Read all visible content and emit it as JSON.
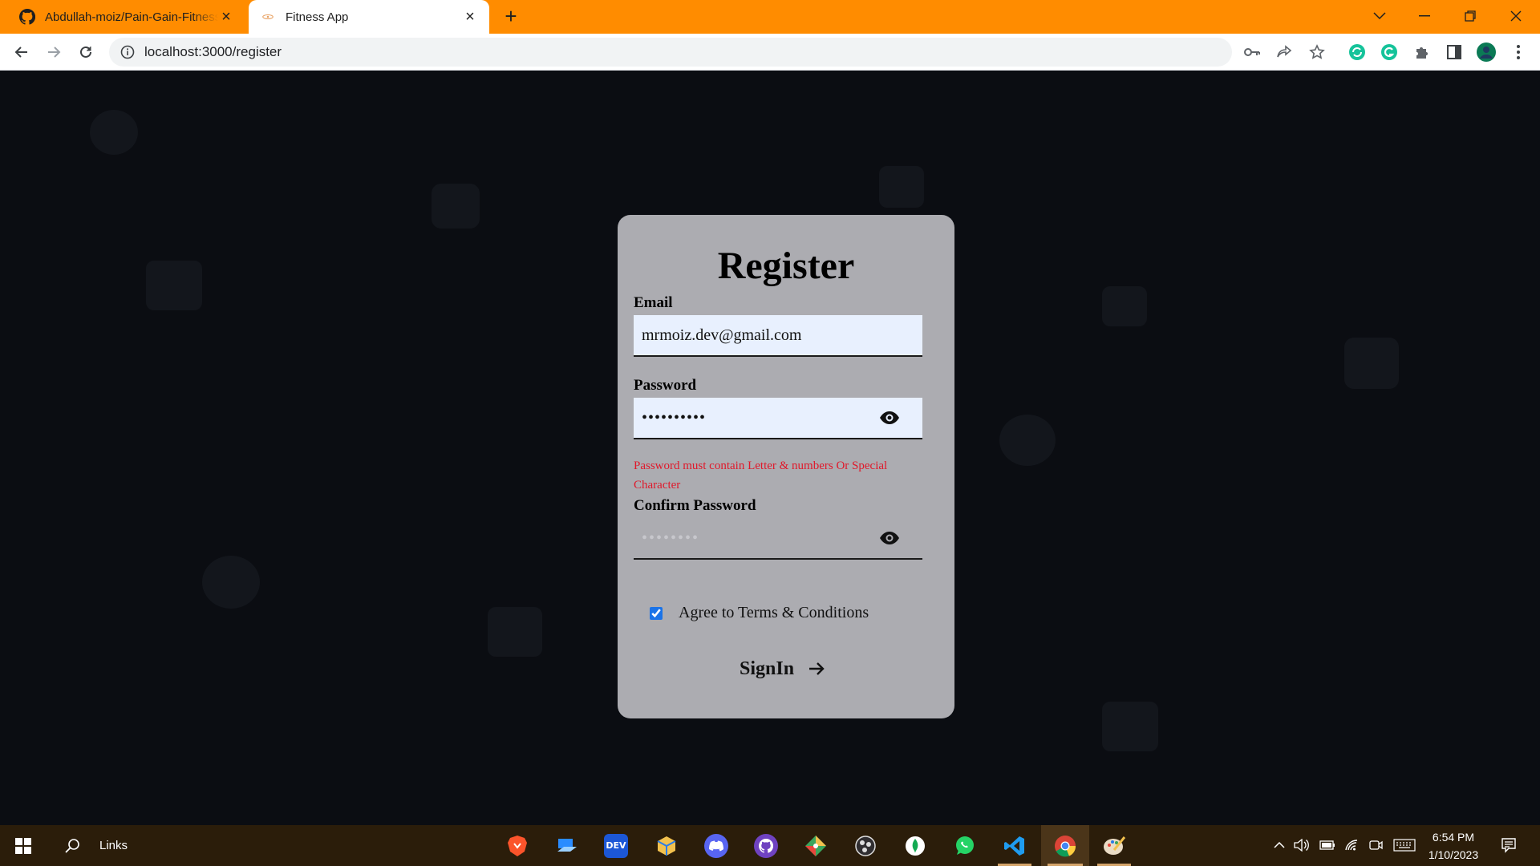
{
  "browser": {
    "tabs": [
      {
        "title": "Abdullah-moiz/Pain-Gain-Fitness",
        "active": false,
        "icon": "github-icon"
      },
      {
        "title": "Fitness App",
        "active": true,
        "icon": "react-icon"
      }
    ],
    "url": "localhost:3000/register",
    "accent_color": "#ff8c00"
  },
  "form": {
    "title": "Register",
    "email_label": "Email",
    "email_value": "mrmoiz.dev@gmail.com",
    "password_label": "Password",
    "password_value": "••••••••••",
    "password_error": "Password must contain Letter & numbers Or Special Character",
    "confirm_label": "Confirm Password",
    "confirm_placeholder": "••••••••",
    "agree_label": "Agree to Terms & Conditions",
    "agree_checked": true,
    "submit_label": "SignIn",
    "error_color": "#e0182a",
    "card_color": "#acacb1"
  },
  "taskbar": {
    "search_label": "Links",
    "time": "6:54 PM",
    "date": "1/10/2023",
    "apps": [
      "brave-icon",
      "file-explorer-icon",
      "dev-community-icon",
      "cube-app-icon",
      "discord-icon",
      "github-desktop-icon",
      "git-kraken-icon",
      "obs-icon",
      "mongodb-compass-icon",
      "whatsapp-icon",
      "vscode-icon",
      "chrome-icon",
      "paint-icon"
    ],
    "dev_icon_text": "DEV"
  }
}
